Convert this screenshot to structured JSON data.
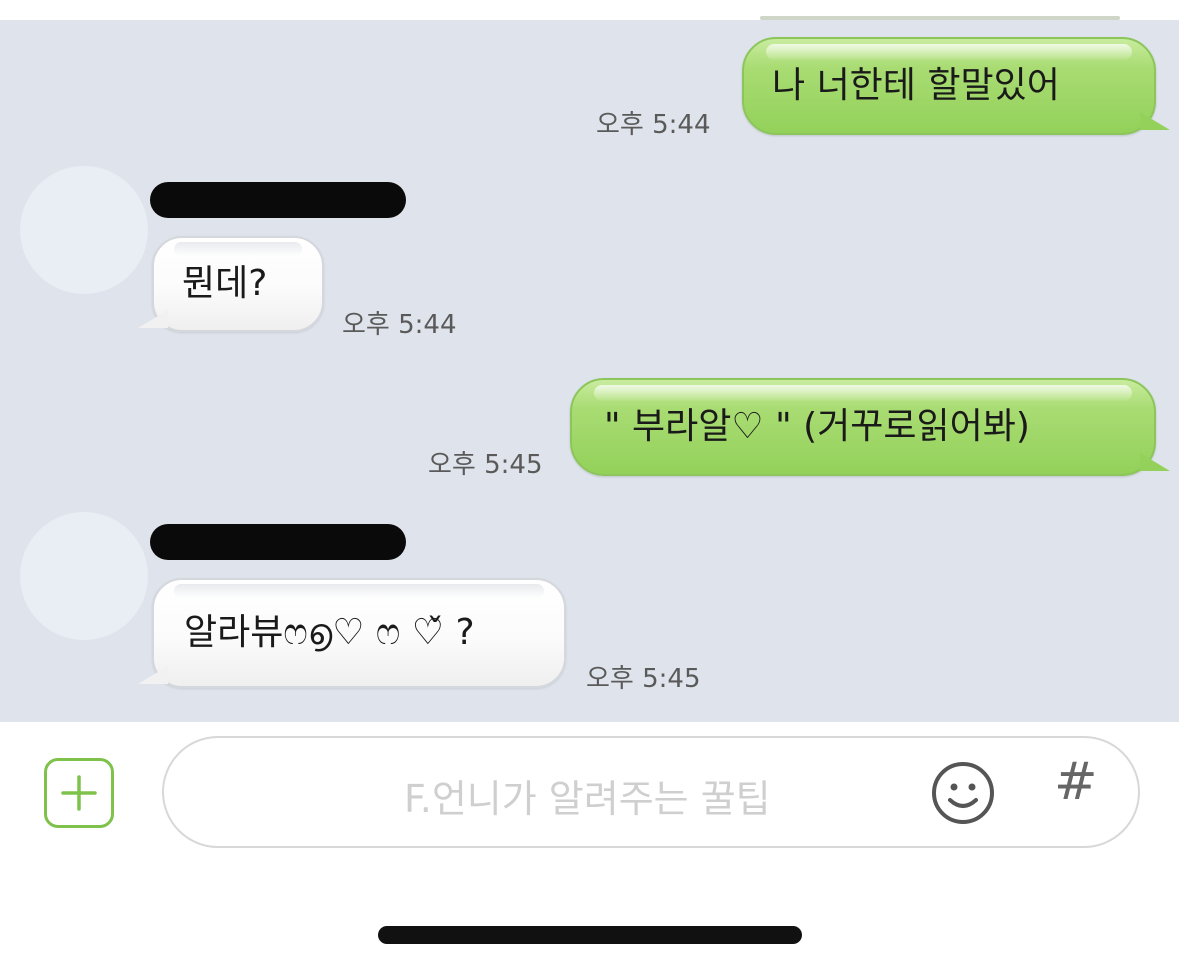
{
  "messages": [
    {
      "direction": "outgoing",
      "text": "나 너한테 할말있어",
      "time": "오후 5:44"
    },
    {
      "direction": "incoming",
      "sender_redacted": true,
      "text": "뭔데?",
      "time": "오후 5:44"
    },
    {
      "direction": "outgoing",
      "text": "\" 부라알♡ \" (거꾸로읽어봐)",
      "time": "오후 5:45"
    },
    {
      "direction": "incoming",
      "sender_redacted": true,
      "text": "알라뷰ෆ൭♡ ෆ ♡̌ ?",
      "time": "오후 5:45"
    }
  ],
  "composer": {
    "plus_icon": "plus-icon",
    "input_text": "F.언니가 알려주는 꿀팁",
    "emoji_icon": "smiley-icon",
    "hash_label": "#"
  },
  "colors": {
    "chat_background": "#dfe4ec",
    "outgoing_bubble": "#a9dc73",
    "incoming_bubble": "#ffffff",
    "accent_green": "#7fc24b"
  }
}
